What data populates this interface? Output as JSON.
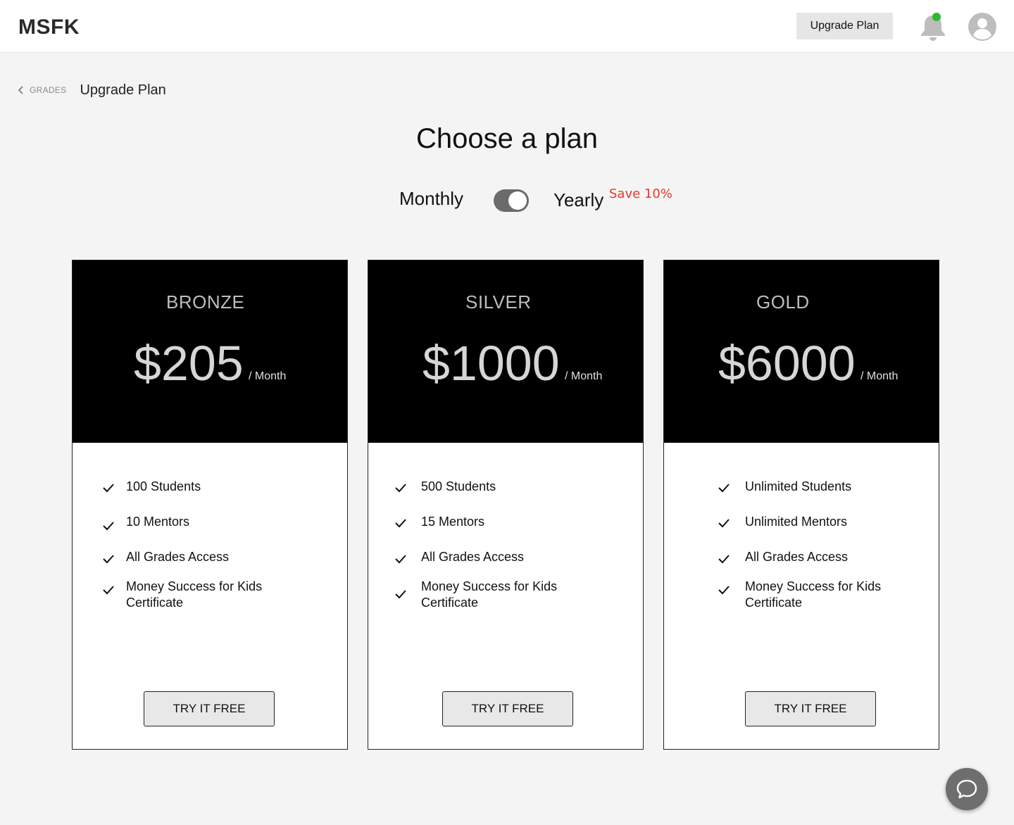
{
  "header": {
    "logo": "MSFK",
    "upgrade_button": "Upgrade Plan",
    "notification_dot_color": "#2eb82e"
  },
  "breadcrumb": {
    "parent": "GRADES",
    "current": "Upgrade Plan"
  },
  "page": {
    "heading": "Choose a plan"
  },
  "billing": {
    "monthly_label": "Monthly",
    "yearly_label": "Yearly",
    "save_badge": "Save 10%",
    "save_badge_color": "#e8382b",
    "toggle_state": "yearly"
  },
  "plans": [
    {
      "tier": "BRONZE",
      "price": "$205",
      "period": "/ Month",
      "features": [
        "100 Students",
        "10 Mentors",
        "All Grades Access",
        "Money Success for Kids",
        "Certificate"
      ],
      "cta": "TRY IT FREE"
    },
    {
      "tier": "SILVER",
      "price": "$1000",
      "period": "/ Month",
      "features": [
        "500 Students",
        "15 Mentors",
        "All Grades Access",
        "Money Success for Kids",
        "Certificate"
      ],
      "cta": "TRY IT FREE"
    },
    {
      "tier": "GOLD",
      "price": "$6000",
      "period": "/ Month",
      "features": [
        "Unlimited Students",
        "Unlimited Mentors",
        "All Grades Access",
        "Money Success for Kids",
        "Certificate"
      ],
      "cta": "TRY IT FREE"
    }
  ],
  "icons": {
    "bell": "bell-icon",
    "avatar": "user-avatar-icon",
    "chat": "chat-bubble-icon",
    "check": "check-icon",
    "back": "chevron-left-icon"
  }
}
